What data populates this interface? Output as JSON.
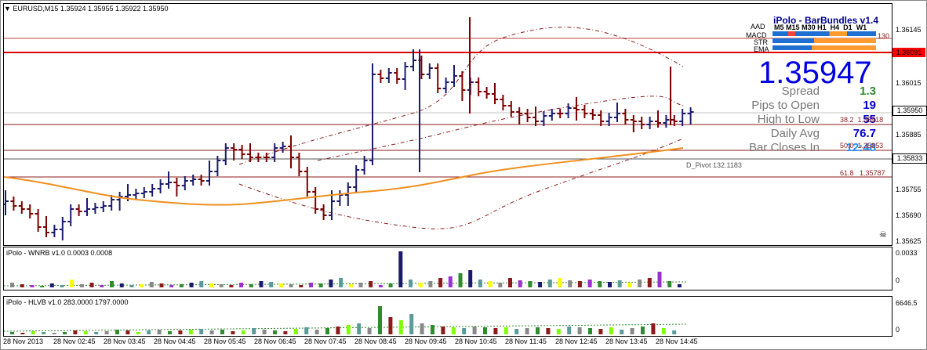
{
  "header": {
    "symbol_line": "EURUSD,M15  1.35924 1.35955 1.35922 1.35950"
  },
  "indicator": {
    "title": "iPolo - BarBundles v1.4",
    "rows": [
      "AAD",
      "MACD",
      "STR",
      "EMA"
    ],
    "tf_labels": [
      "M5",
      "M15",
      "M30",
      "H1",
      "H4",
      "D1",
      "W1"
    ],
    "price": "1.35947",
    "stats": [
      {
        "label": "Spread",
        "value": "1.3",
        "color": "#2e8b2e"
      },
      {
        "label": "Pips to Open",
        "value": "19",
        "color": "#0000cc"
      },
      {
        "label": "High to Low",
        "value": "55",
        "color": "#0000cc"
      },
      {
        "label": "Daily Avg",
        "value": "76.7",
        "color": "#0000cc"
      },
      {
        "label": "Bar Closes In",
        "value": "12:48",
        "color": "#1e90ff"
      }
    ]
  },
  "price_axis": {
    "ticks": [
      "1.36145",
      "1.36015",
      "1.35885",
      "1.35755",
      "1.35690",
      "1.35625"
    ],
    "boxes": [
      {
        "text": "1.36091",
        "bg": "#ff0000",
        "fg": "#000"
      },
      {
        "text": "1.35950",
        "bg": "#ffffff",
        "fg": "#000"
      },
      {
        "text": "1.35833",
        "bg": "#ffffff",
        "fg": "#000"
      }
    ]
  },
  "fib_labels": [
    {
      "pct": "38.2",
      "price": "1.35918"
    },
    {
      "pct": "50.0",
      "price": "1.35853"
    },
    {
      "pct": "61.8",
      "price": "1.35787"
    }
  ],
  "pivot_label": "D_Pivot 132.1183",
  "partial_labels": {
    "resist_tail": "130"
  },
  "wnrb": {
    "title": "iPolo - WNRB v1.0 0.0003 0.0008",
    "axis_top": "0.0033",
    "axis_zero": "0"
  },
  "hlvb": {
    "title": "iPolo - HLVB v1.0 283.0000 1797.0000",
    "axis_top": "6646.5",
    "axis_zero": "0"
  },
  "time_axis": [
    "28 Nov 2013",
    "28 Nov 02:45",
    "28 Nov 03:45",
    "28 Nov 04:45",
    "28 Nov 05:45",
    "28 Nov 06:45",
    "28 Nov 07:45",
    "28 Nov 08:45",
    "28 Nov 09:45",
    "28 Nov 10:45",
    "28 Nov 11:45",
    "28 Nov 12:45",
    "28 Nov 13:45",
    "28 Nov 14:45"
  ],
  "colors": {
    "bull": "#1a1a6e",
    "bear": "#7a0000",
    "ema": "#f0901e",
    "band": "#8b1a1a",
    "resist": "#e00000"
  }
}
